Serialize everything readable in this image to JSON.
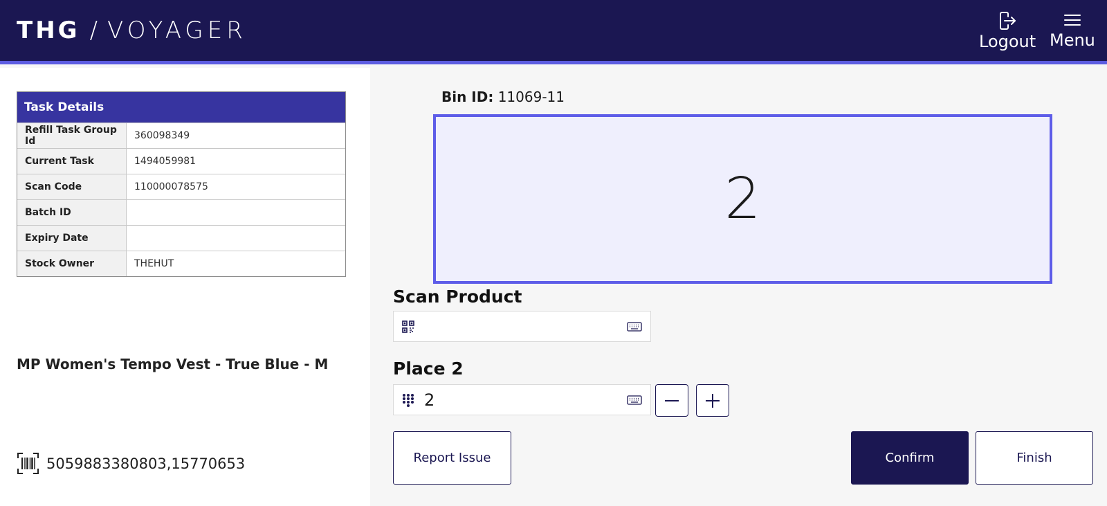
{
  "header": {
    "logo_brand": "THG",
    "logo_slash": "/",
    "logo_product": "VOYAGER",
    "logout_label": "Logout",
    "menu_label": "Menu"
  },
  "task_details": {
    "title": "Task Details",
    "rows": [
      {
        "label": "Refill Task Group Id",
        "value": "360098349"
      },
      {
        "label": "Current Task",
        "value": "1494059981"
      },
      {
        "label": "Scan Code",
        "value": "110000078575"
      },
      {
        "label": "Batch ID",
        "value": ""
      },
      {
        "label": "Expiry Date",
        "value": ""
      },
      {
        "label": "Stock Owner",
        "value": "THEHUT"
      }
    ]
  },
  "product": {
    "name": "MP Women's Tempo Vest - True Blue - M",
    "barcodes": "5059883380803,15770653"
  },
  "bin": {
    "label": "Bin ID:",
    "id": "11069-11",
    "quantity": "2"
  },
  "scan_product": {
    "label": "Scan Product",
    "value": ""
  },
  "place": {
    "label": "Place 2",
    "value": "2"
  },
  "actions": {
    "report_issue": "Report Issue",
    "confirm": "Confirm",
    "finish": "Finish"
  },
  "colors": {
    "header_bg": "#1b1752",
    "accent": "#5c5ce0",
    "table_header": "#3734a0",
    "bin_bg": "#efeffd"
  }
}
